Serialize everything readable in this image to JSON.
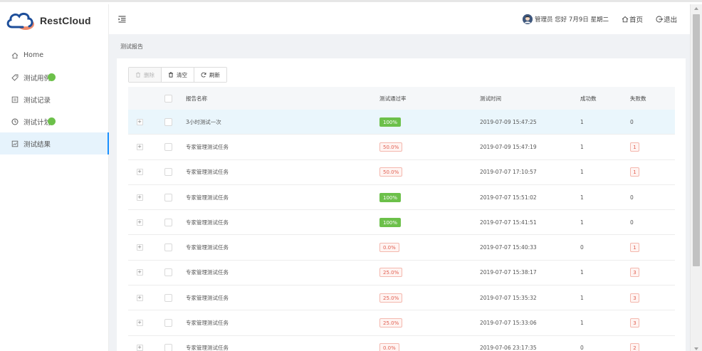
{
  "app": {
    "brand": "RestCloud"
  },
  "sidebar": {
    "items": [
      {
        "label": "Home",
        "icon": "home-icon"
      },
      {
        "label": "测试用例",
        "icon": "tag-icon"
      },
      {
        "label": "测试记录",
        "icon": "record-icon"
      },
      {
        "label": "测试计划",
        "icon": "clock-icon"
      },
      {
        "label": "测试结果",
        "icon": "chart-icon"
      }
    ],
    "active_index": 4
  },
  "header": {
    "greeting": "管理员 您好 7月9日 星期二",
    "home_link": "首页",
    "logout_link": "退出"
  },
  "breadcrumb": "测试报告",
  "toolbar": {
    "delete_label": "删除",
    "clear_label": "清空",
    "refresh_label": "刷新"
  },
  "table": {
    "columns": {
      "name": "报告名称",
      "rate": "测试通过率",
      "time": "测试时间",
      "success": "成功数",
      "fail": "失败数"
    },
    "rows": [
      {
        "name": "3小时测试一次",
        "rate": "100%",
        "time": "2019-07-09 15:47:25",
        "success": "1",
        "fail": "0",
        "pass": true,
        "selected": true
      },
      {
        "name": "专家管理测试任务",
        "rate": "50.0%",
        "time": "2019-07-09 15:47:19",
        "success": "1",
        "fail": "1",
        "pass": false,
        "selected": false
      },
      {
        "name": "专家管理测试任务",
        "rate": "50.0%",
        "time": "2019-07-07 17:10:57",
        "success": "1",
        "fail": "1",
        "pass": false,
        "selected": false
      },
      {
        "name": "专家管理测试任务",
        "rate": "100%",
        "time": "2019-07-07 15:51:02",
        "success": "1",
        "fail": "0",
        "pass": true,
        "selected": false
      },
      {
        "name": "专家管理测试任务",
        "rate": "100%",
        "time": "2019-07-07 15:41:51",
        "success": "1",
        "fail": "0",
        "pass": true,
        "selected": false
      },
      {
        "name": "专家管理测试任务",
        "rate": "0.0%",
        "time": "2019-07-07 15:40:33",
        "success": "0",
        "fail": "1",
        "pass": false,
        "selected": false
      },
      {
        "name": "专家管理测试任务",
        "rate": "25.0%",
        "time": "2019-07-07 15:38:17",
        "success": "1",
        "fail": "3",
        "pass": false,
        "selected": false
      },
      {
        "name": "专家管理测试任务",
        "rate": "25.0%",
        "time": "2019-07-07 15:35:32",
        "success": "1",
        "fail": "3",
        "pass": false,
        "selected": false
      },
      {
        "name": "专家管理测试任务",
        "rate": "25.0%",
        "time": "2019-07-07 15:33:06",
        "success": "1",
        "fail": "3",
        "pass": false,
        "selected": false
      },
      {
        "name": "专家管理测试任务",
        "rate": "0.0%",
        "time": "2019-07-06 23:17:35",
        "success": "0",
        "fail": "2",
        "pass": false,
        "selected": false
      }
    ]
  },
  "colors": {
    "accent": "#1890ff",
    "success": "#6cc04a",
    "danger": "#e06052"
  }
}
